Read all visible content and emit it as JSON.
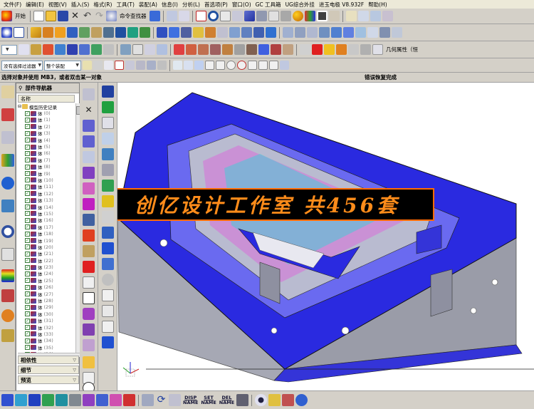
{
  "menu": {
    "items": [
      "文件(F)",
      "编辑(E)",
      "视图(V)",
      "插入(S)",
      "格式(R)",
      "工具(T)",
      "装配(A)",
      "信息(I)",
      "分析(L)",
      "首选项(P)",
      "窗口(O)",
      "GC 工具箱",
      "UG综合外挂",
      "进玉电极 V8.932F",
      "帮助(H)"
    ]
  },
  "toolbar1": {
    "start_label": "开始",
    "command_finder_label": "命令查找器"
  },
  "toolbar3": {
    "geometry_label": "几何属性（恒"
  },
  "toolbar4": {
    "filter_value": "没有选择过滤器",
    "assembly_value": "整个装配"
  },
  "status": {
    "prompt": "选择对象并使用 MB3，或者双击某一对象",
    "message": "错误恢复完成"
  },
  "navigator": {
    "title": "部件导航器",
    "column_header": "名称",
    "root_label": "模型历史记录",
    "body_label": "体",
    "rows": [
      "(0)",
      "(1)",
      "(2)",
      "(3)",
      "(4)",
      "(5)",
      "(6)",
      "(7)",
      "(8)",
      "(9)",
      "(10)",
      "(11)",
      "(12)",
      "(13)",
      "(14)",
      "(15)",
      "(16)",
      "(17)",
      "(18)",
      "(19)",
      "(20)",
      "(21)",
      "(22)",
      "(23)",
      "(24)",
      "(25)",
      "(26)",
      "(27)",
      "(28)",
      "(29)",
      "(30)",
      "(31)",
      "(32)",
      "(33)",
      "(34)",
      "(35)",
      "(36)"
    ],
    "sections": [
      "相依性",
      "细节",
      "预览"
    ]
  },
  "watermark": {
    "text": "创亿设计工作室 共456套"
  },
  "bottom": {
    "disp_name_top": "DISP",
    "set_name_top": "SET",
    "del_name_top": "DEL",
    "name_label": "NAME"
  },
  "colors": {
    "mold_blue": "#2828e0",
    "mold_gray": "#a8a8b0",
    "watermark_orange": "#ff8c1a"
  }
}
